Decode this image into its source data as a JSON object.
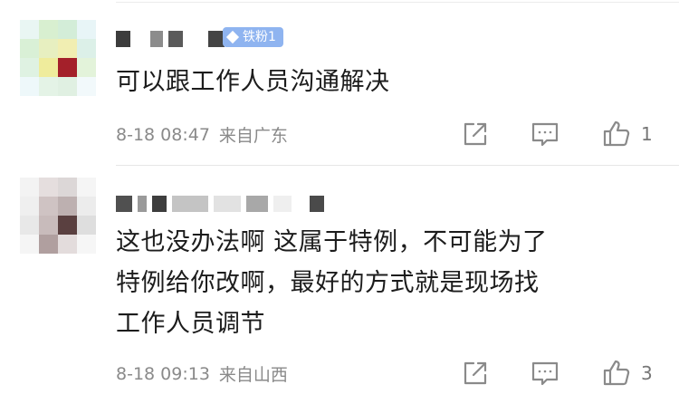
{
  "comments": [
    {
      "badge_label": "铁粉1",
      "content_lines": [
        "可以跟工作人员沟通解决"
      ],
      "date": "8-18 08:47",
      "location": "来自广东",
      "like_count": "1"
    },
    {
      "content_lines": [
        "这也没办法啊 这属于特例，不可能为了",
        "特例给你改啊，最好的方式就是现场找",
        "工作人员调节"
      ],
      "date": "8-18 09:13",
      "location": "来自山西",
      "like_count": "3"
    }
  ],
  "colors": {
    "badge_bg": "#8fb4f0",
    "meta_text": "#8a8a8a",
    "icon_stroke": "#8a8a8a"
  },
  "icons": [
    "share-icon",
    "comment-icon",
    "thumbs-up-icon"
  ]
}
